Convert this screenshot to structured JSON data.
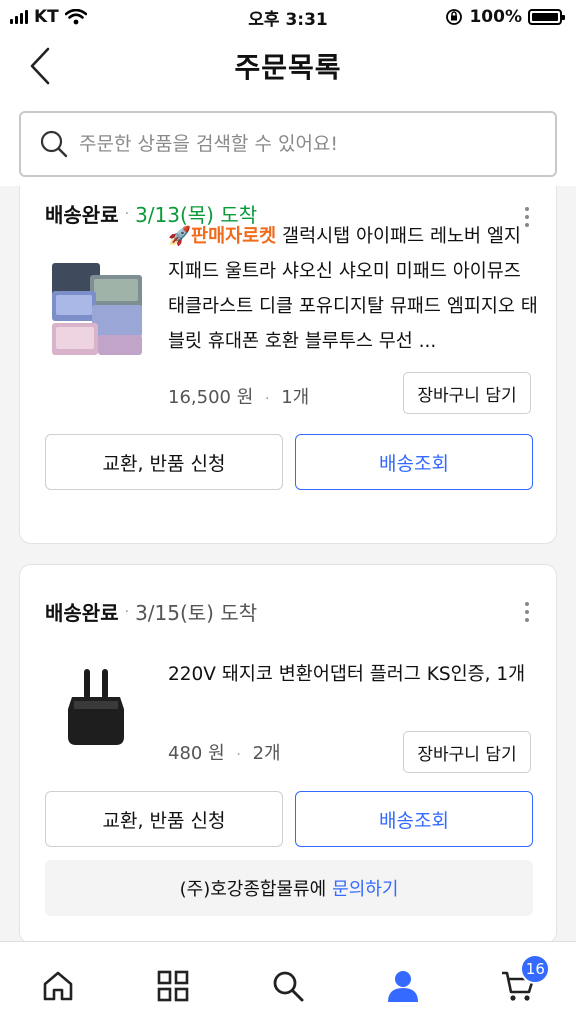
{
  "status_bar": {
    "carrier": "KT",
    "time": "오후 3:31",
    "battery": "100%"
  },
  "header": {
    "title": "주문목록"
  },
  "search": {
    "placeholder": "주문한 상품을 검색할 수 있어요!"
  },
  "orders": [
    {
      "status": "배송완료",
      "arrival": "3/13(목) 도착",
      "badge": "판매자로켓",
      "title": "갤럭시탭 아이패드 레노버 엘지 지패드 울트라 샤오신 샤오미 미패드 아이뮤즈 태클라스트 디클 포유디지탈 뮤패드 엠피지오 태블릿 휴대폰 호환 블루투스 무선 ...",
      "price": "16,500 원",
      "qty": "1개",
      "cart_label": "장바구니 담기",
      "return_label": "교환, 반품 신청",
      "tracking_label": "배송조회"
    },
    {
      "status": "배송완료",
      "arrival": "3/15(토) 도착",
      "title": "220V 돼지코 변환어댑터 플러그 KS인증, 1개",
      "price": "480 원",
      "qty": "2개",
      "cart_label": "장바구니 담기",
      "return_label": "교환, 반품 신청",
      "tracking_label": "배송조회",
      "seller_text": "(주)호강종합물류에",
      "contact_link": "문의하기"
    }
  ],
  "bottom_nav": {
    "cart_badge": "16"
  },
  "colors": {
    "accent_blue": "#346aff",
    "arrival_green": "#0b9a3a",
    "rocket_orange": "#f26b1d"
  },
  "icons": [
    "chevron-left-icon",
    "search-icon",
    "more-vertical-icon",
    "home-icon",
    "category-grid-icon",
    "person-icon",
    "cart-icon"
  ]
}
